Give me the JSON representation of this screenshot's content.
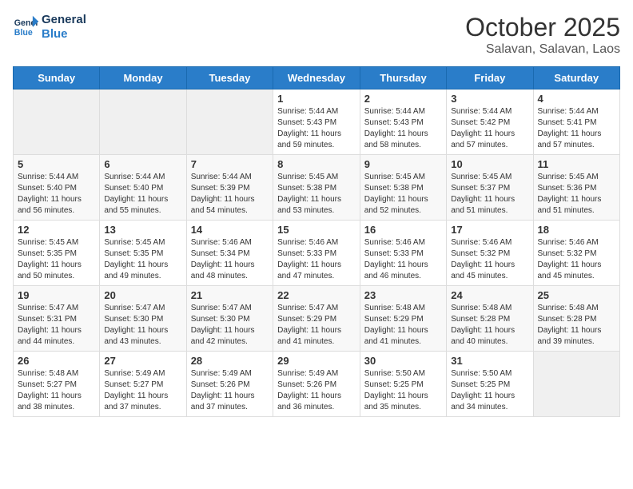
{
  "logo": {
    "line1": "General",
    "line2": "Blue"
  },
  "header": {
    "month": "October 2025",
    "location": "Salavan, Salavan, Laos"
  },
  "weekdays": [
    "Sunday",
    "Monday",
    "Tuesday",
    "Wednesday",
    "Thursday",
    "Friday",
    "Saturday"
  ],
  "weeks": [
    [
      {
        "day": "",
        "info": ""
      },
      {
        "day": "",
        "info": ""
      },
      {
        "day": "",
        "info": ""
      },
      {
        "day": "1",
        "info": "Sunrise: 5:44 AM\nSunset: 5:43 PM\nDaylight: 11 hours\nand 59 minutes."
      },
      {
        "day": "2",
        "info": "Sunrise: 5:44 AM\nSunset: 5:43 PM\nDaylight: 11 hours\nand 58 minutes."
      },
      {
        "day": "3",
        "info": "Sunrise: 5:44 AM\nSunset: 5:42 PM\nDaylight: 11 hours\nand 57 minutes."
      },
      {
        "day": "4",
        "info": "Sunrise: 5:44 AM\nSunset: 5:41 PM\nDaylight: 11 hours\nand 57 minutes."
      }
    ],
    [
      {
        "day": "5",
        "info": "Sunrise: 5:44 AM\nSunset: 5:40 PM\nDaylight: 11 hours\nand 56 minutes."
      },
      {
        "day": "6",
        "info": "Sunrise: 5:44 AM\nSunset: 5:40 PM\nDaylight: 11 hours\nand 55 minutes."
      },
      {
        "day": "7",
        "info": "Sunrise: 5:44 AM\nSunset: 5:39 PM\nDaylight: 11 hours\nand 54 minutes."
      },
      {
        "day": "8",
        "info": "Sunrise: 5:45 AM\nSunset: 5:38 PM\nDaylight: 11 hours\nand 53 minutes."
      },
      {
        "day": "9",
        "info": "Sunrise: 5:45 AM\nSunset: 5:38 PM\nDaylight: 11 hours\nand 52 minutes."
      },
      {
        "day": "10",
        "info": "Sunrise: 5:45 AM\nSunset: 5:37 PM\nDaylight: 11 hours\nand 51 minutes."
      },
      {
        "day": "11",
        "info": "Sunrise: 5:45 AM\nSunset: 5:36 PM\nDaylight: 11 hours\nand 51 minutes."
      }
    ],
    [
      {
        "day": "12",
        "info": "Sunrise: 5:45 AM\nSunset: 5:35 PM\nDaylight: 11 hours\nand 50 minutes."
      },
      {
        "day": "13",
        "info": "Sunrise: 5:45 AM\nSunset: 5:35 PM\nDaylight: 11 hours\nand 49 minutes."
      },
      {
        "day": "14",
        "info": "Sunrise: 5:46 AM\nSunset: 5:34 PM\nDaylight: 11 hours\nand 48 minutes."
      },
      {
        "day": "15",
        "info": "Sunrise: 5:46 AM\nSunset: 5:33 PM\nDaylight: 11 hours\nand 47 minutes."
      },
      {
        "day": "16",
        "info": "Sunrise: 5:46 AM\nSunset: 5:33 PM\nDaylight: 11 hours\nand 46 minutes."
      },
      {
        "day": "17",
        "info": "Sunrise: 5:46 AM\nSunset: 5:32 PM\nDaylight: 11 hours\nand 45 minutes."
      },
      {
        "day": "18",
        "info": "Sunrise: 5:46 AM\nSunset: 5:32 PM\nDaylight: 11 hours\nand 45 minutes."
      }
    ],
    [
      {
        "day": "19",
        "info": "Sunrise: 5:47 AM\nSunset: 5:31 PM\nDaylight: 11 hours\nand 44 minutes."
      },
      {
        "day": "20",
        "info": "Sunrise: 5:47 AM\nSunset: 5:30 PM\nDaylight: 11 hours\nand 43 minutes."
      },
      {
        "day": "21",
        "info": "Sunrise: 5:47 AM\nSunset: 5:30 PM\nDaylight: 11 hours\nand 42 minutes."
      },
      {
        "day": "22",
        "info": "Sunrise: 5:47 AM\nSunset: 5:29 PM\nDaylight: 11 hours\nand 41 minutes."
      },
      {
        "day": "23",
        "info": "Sunrise: 5:48 AM\nSunset: 5:29 PM\nDaylight: 11 hours\nand 41 minutes."
      },
      {
        "day": "24",
        "info": "Sunrise: 5:48 AM\nSunset: 5:28 PM\nDaylight: 11 hours\nand 40 minutes."
      },
      {
        "day": "25",
        "info": "Sunrise: 5:48 AM\nSunset: 5:28 PM\nDaylight: 11 hours\nand 39 minutes."
      }
    ],
    [
      {
        "day": "26",
        "info": "Sunrise: 5:48 AM\nSunset: 5:27 PM\nDaylight: 11 hours\nand 38 minutes."
      },
      {
        "day": "27",
        "info": "Sunrise: 5:49 AM\nSunset: 5:27 PM\nDaylight: 11 hours\nand 37 minutes."
      },
      {
        "day": "28",
        "info": "Sunrise: 5:49 AM\nSunset: 5:26 PM\nDaylight: 11 hours\nand 37 minutes."
      },
      {
        "day": "29",
        "info": "Sunrise: 5:49 AM\nSunset: 5:26 PM\nDaylight: 11 hours\nand 36 minutes."
      },
      {
        "day": "30",
        "info": "Sunrise: 5:50 AM\nSunset: 5:25 PM\nDaylight: 11 hours\nand 35 minutes."
      },
      {
        "day": "31",
        "info": "Sunrise: 5:50 AM\nSunset: 5:25 PM\nDaylight: 11 hours\nand 34 minutes."
      },
      {
        "day": "",
        "info": ""
      }
    ]
  ]
}
